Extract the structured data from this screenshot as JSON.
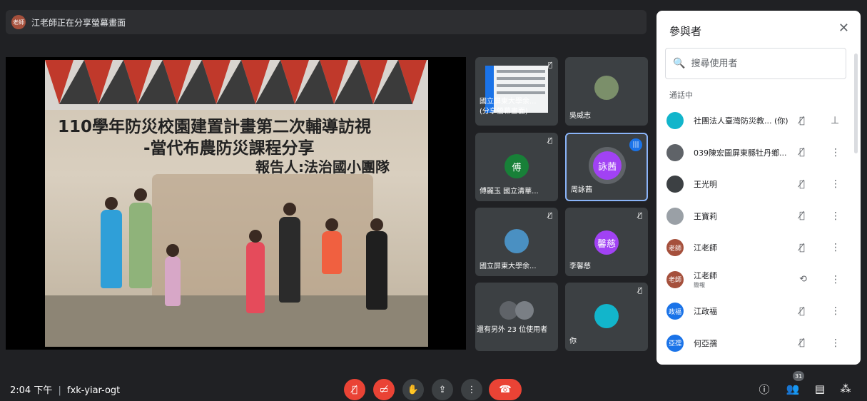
{
  "presenter_bar": {
    "avatar_label": "老師",
    "text": "江老師正在分享螢幕畫面"
  },
  "slide": {
    "line1": "110學年防災校園建置計畫第二次輔導訪視",
    "line2": "-當代布農防災課程分享",
    "line3": "報告人:法治國小團隊"
  },
  "tiles": [
    {
      "name": "國立屏東大學余...\n(分享螢幕畫面)",
      "name_line1": "國立屏東大學余...",
      "name_line2": "(分享螢幕畫面)"
    },
    {
      "name": "吳威志"
    },
    {
      "name": "傅麗玉 國立清華...",
      "avatar": "傅",
      "color": "#188038"
    },
    {
      "name": "周詠茜",
      "avatar": "詠茜",
      "color": "#a142f4"
    },
    {
      "name": "國立屏東大學余..."
    },
    {
      "name": "李馨慈",
      "avatar": "馨慈",
      "color": "#a142f4"
    },
    {
      "name": "還有另外 23 位使用者"
    },
    {
      "name": "你"
    }
  ],
  "bottom": {
    "time": "2:04 下午",
    "separator": "|",
    "meeting_code": "fxk-yiar-ogt",
    "people_count": "31"
  },
  "panel": {
    "title": "參與者",
    "search_placeholder": "搜尋使用者",
    "section": "通話中",
    "participants": [
      {
        "name": "社團法人臺灣防災教... (你)",
        "avatar": "",
        "color": "#12b5cb",
        "sub": ""
      },
      {
        "name": "039陳宏圖屏東縣牡丹鄉...",
        "avatar": "",
        "color": "#5f6368",
        "sub": ""
      },
      {
        "name": "王光明",
        "avatar": "",
        "color": "#3c4043",
        "sub": ""
      },
      {
        "name": "王寶莉",
        "avatar": "",
        "color": "#9aa0a6",
        "sub": ""
      },
      {
        "name": "江老師",
        "avatar": "老師",
        "color": "#a5503c",
        "sub": ""
      },
      {
        "name": "江老師",
        "avatar": "老師",
        "color": "#a5503c",
        "sub": "簡報"
      },
      {
        "name": "江政福",
        "avatar": "政福",
        "color": "#1a73e8",
        "sub": ""
      },
      {
        "name": "何亞孺",
        "avatar": "亞孺",
        "color": "#1a73e8",
        "sub": ""
      }
    ]
  },
  "icons": {
    "mic_off": "mic-off-icon",
    "cam_off": "camera-off-icon",
    "hand": "hand-icon",
    "present": "present-icon",
    "more": "more-icon",
    "end_call": "end-call-icon",
    "info": "info-icon",
    "people": "people-icon",
    "chat": "chat-icon",
    "activities": "activities-icon"
  }
}
